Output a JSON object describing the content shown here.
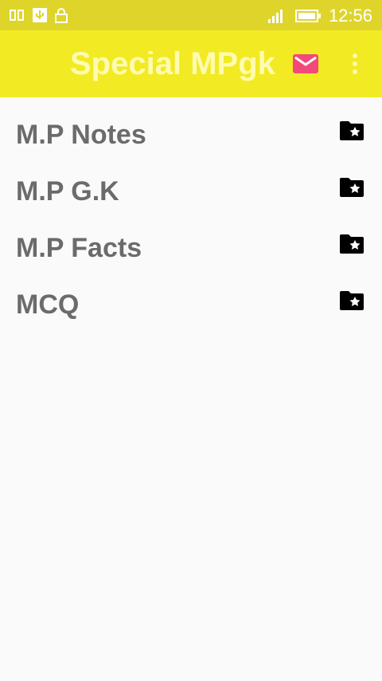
{
  "status_bar": {
    "time": "12:56"
  },
  "app_bar": {
    "title": "Special MPgk",
    "icons": [
      "mail-icon",
      "overflow-menu-icon"
    ],
    "mail_color": "#f2487a"
  },
  "list": {
    "items": [
      {
        "label": "M.P Notes",
        "icon": "folder-star-icon"
      },
      {
        "label": "M.P G.K",
        "icon": "folder-star-icon"
      },
      {
        "label": "M.P Facts",
        "icon": "folder-star-icon"
      },
      {
        "label": "MCQ",
        "icon": "folder-star-icon"
      }
    ]
  },
  "colors": {
    "status_bar": "#dfd52a",
    "app_bar": "#f2ea23",
    "title_text": "#fffbb0",
    "item_text": "#6b6b6b",
    "background": "#fafafa"
  }
}
